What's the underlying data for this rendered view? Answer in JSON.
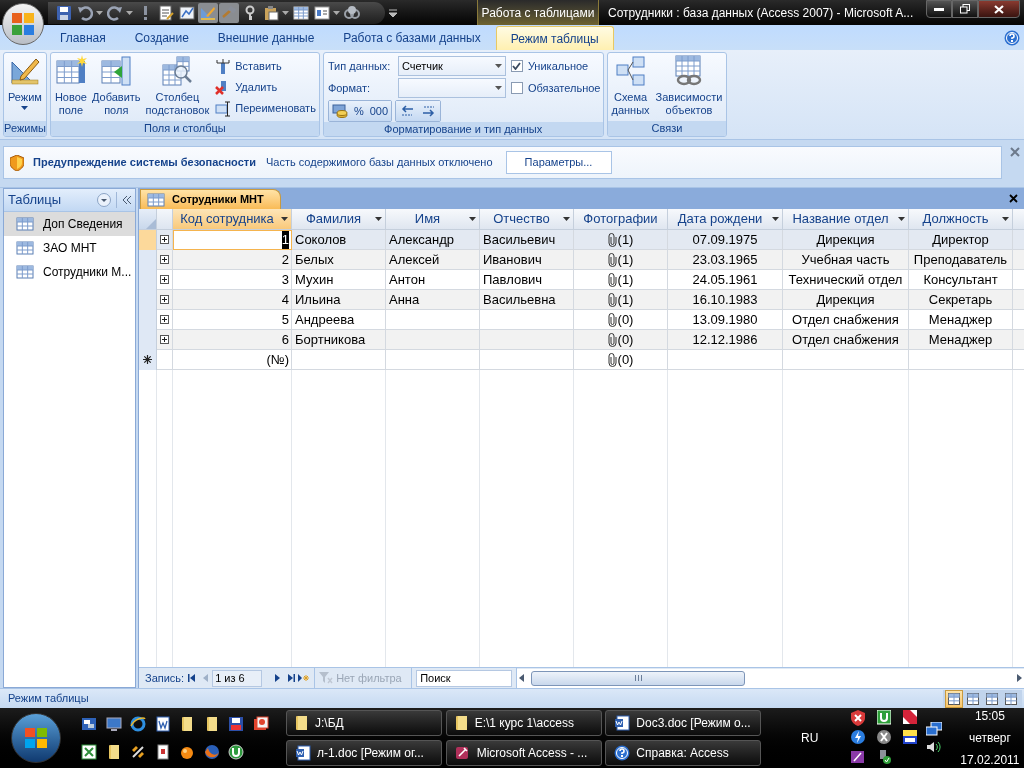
{
  "title_bar": {
    "context_tab": "Работа с таблицами",
    "title": "Сотрудники : база данных (Access 2007) - Microsoft A..."
  },
  "ribbon_tabs": [
    {
      "label": "Главная",
      "selected": false
    },
    {
      "label": "Создание",
      "selected": false
    },
    {
      "label": "Внешние данные",
      "selected": false
    },
    {
      "label": "Работа с базами данных",
      "selected": false
    },
    {
      "label": "Режим таблицы",
      "selected": true
    }
  ],
  "ribbon": {
    "views": {
      "button": "Режим",
      "label": "Режимы"
    },
    "fields": {
      "big_buttons": [
        "Новое\nполе",
        "Добавить\nполя",
        "Столбец\nподстановок"
      ],
      "small_buttons": [
        "Вставить",
        "Удалить",
        "Переименовать"
      ],
      "label": "Поля и столбцы"
    },
    "formatting": {
      "data_type_label": "Тип данных:",
      "data_type": "Счетчик",
      "format_label": "Формат:",
      "percent": "%",
      "thousands": "000",
      "checkboxes": [
        {
          "label": "Уникальное",
          "checked": true
        },
        {
          "label": "Обязательное",
          "checked": false
        }
      ],
      "label": "Форматирование и тип данных"
    },
    "relations": {
      "buttons": [
        "Схема\nданных",
        "Зависимости\nобъектов"
      ],
      "label": "Связи"
    }
  },
  "security_bar": {
    "title": "Предупреждение системы безопасности",
    "message": "Часть содержимого базы данных отключено",
    "button": "Параметры..."
  },
  "nav_pane": {
    "header": "Таблицы",
    "items": [
      {
        "label": "Доп Сведения",
        "selected": true
      },
      {
        "label": "ЗАО МНТ",
        "selected": false
      },
      {
        "label": "Сотрудники М...",
        "selected": false
      }
    ]
  },
  "document_tab": "Сотрудники МНТ",
  "table": {
    "columns": [
      {
        "label": "Код сотрудника",
        "kind": "number",
        "selected": true,
        "dropdown": true
      },
      {
        "label": "Фамилия",
        "kind": "text",
        "selected": false,
        "dropdown": true
      },
      {
        "label": "Имя",
        "kind": "text",
        "selected": false,
        "dropdown": true
      },
      {
        "label": "Отчество",
        "kind": "text",
        "selected": false,
        "dropdown": true
      },
      {
        "label": "Фотографии",
        "kind": "attachment",
        "selected": false,
        "dropdown": false
      },
      {
        "label": "Дата рождени",
        "kind": "date",
        "selected": false,
        "dropdown": true
      },
      {
        "label": "Название отдел",
        "kind": "lookup",
        "selected": false,
        "dropdown": true
      },
      {
        "label": "Должность",
        "kind": "lookup",
        "selected": false,
        "dropdown": true
      }
    ],
    "rows": [
      {
        "selected": true,
        "cells": [
          "1",
          "Соколов",
          "Александр",
          "Васильевич",
          "(1)",
          "07.09.1975",
          "Дирекция",
          "Директор"
        ]
      },
      {
        "selected": false,
        "cells": [
          "2",
          "Белых",
          "Алексей",
          "Иванович",
          "(1)",
          "23.03.1965",
          "Учебная часть",
          "Преподаватель"
        ]
      },
      {
        "selected": false,
        "cells": [
          "3",
          "Мухин",
          "Антон",
          "Павлович",
          "(1)",
          "24.05.1961",
          "Технический отдел",
          "Консультант"
        ]
      },
      {
        "selected": false,
        "cells": [
          "4",
          "Ильина",
          "Анна",
          "Васильевна",
          "(1)",
          "16.10.1983",
          "Дирекция",
          "Секретарь"
        ]
      },
      {
        "selected": false,
        "cells": [
          "5",
          "Андреева",
          null,
          null,
          "(0)",
          "13.09.1980",
          "Отдел снабжения",
          "Менаджер"
        ]
      },
      {
        "selected": false,
        "cells": [
          "6",
          "Бортникова",
          null,
          null,
          "(0)",
          "12.12.1986",
          "Отдел снабжения",
          "Менаджер"
        ]
      }
    ],
    "new_row": {
      "id": "(№)",
      "attachments": "(0)"
    }
  },
  "record_nav": {
    "label": "Запись:",
    "position": "1 из 6",
    "filter": "Нет фильтра",
    "search": "Поиск"
  },
  "status_bar": {
    "text": "Режим таблицы",
    "views": [
      {
        "selected": true
      },
      {
        "selected": false
      },
      {
        "selected": false
      },
      {
        "selected": false
      }
    ]
  },
  "taskbar": {
    "tasks": [
      {
        "label": "J:\\БД",
        "kind": "folder"
      },
      {
        "label": "E:\\1 курс 1\\access",
        "kind": "folder"
      },
      {
        "label": "Doc3.doc [Режим о...",
        "kind": "word"
      },
      {
        "label": "л-1.doc [Режим ог...",
        "kind": "word"
      },
      {
        "label": "Microsoft Access - ...",
        "kind": "access"
      },
      {
        "label": "Справка: Access",
        "kind": "help"
      }
    ],
    "language": "RU",
    "clock": {
      "time": "15:05",
      "day": "четверг",
      "date": "17.02.2011"
    }
  }
}
